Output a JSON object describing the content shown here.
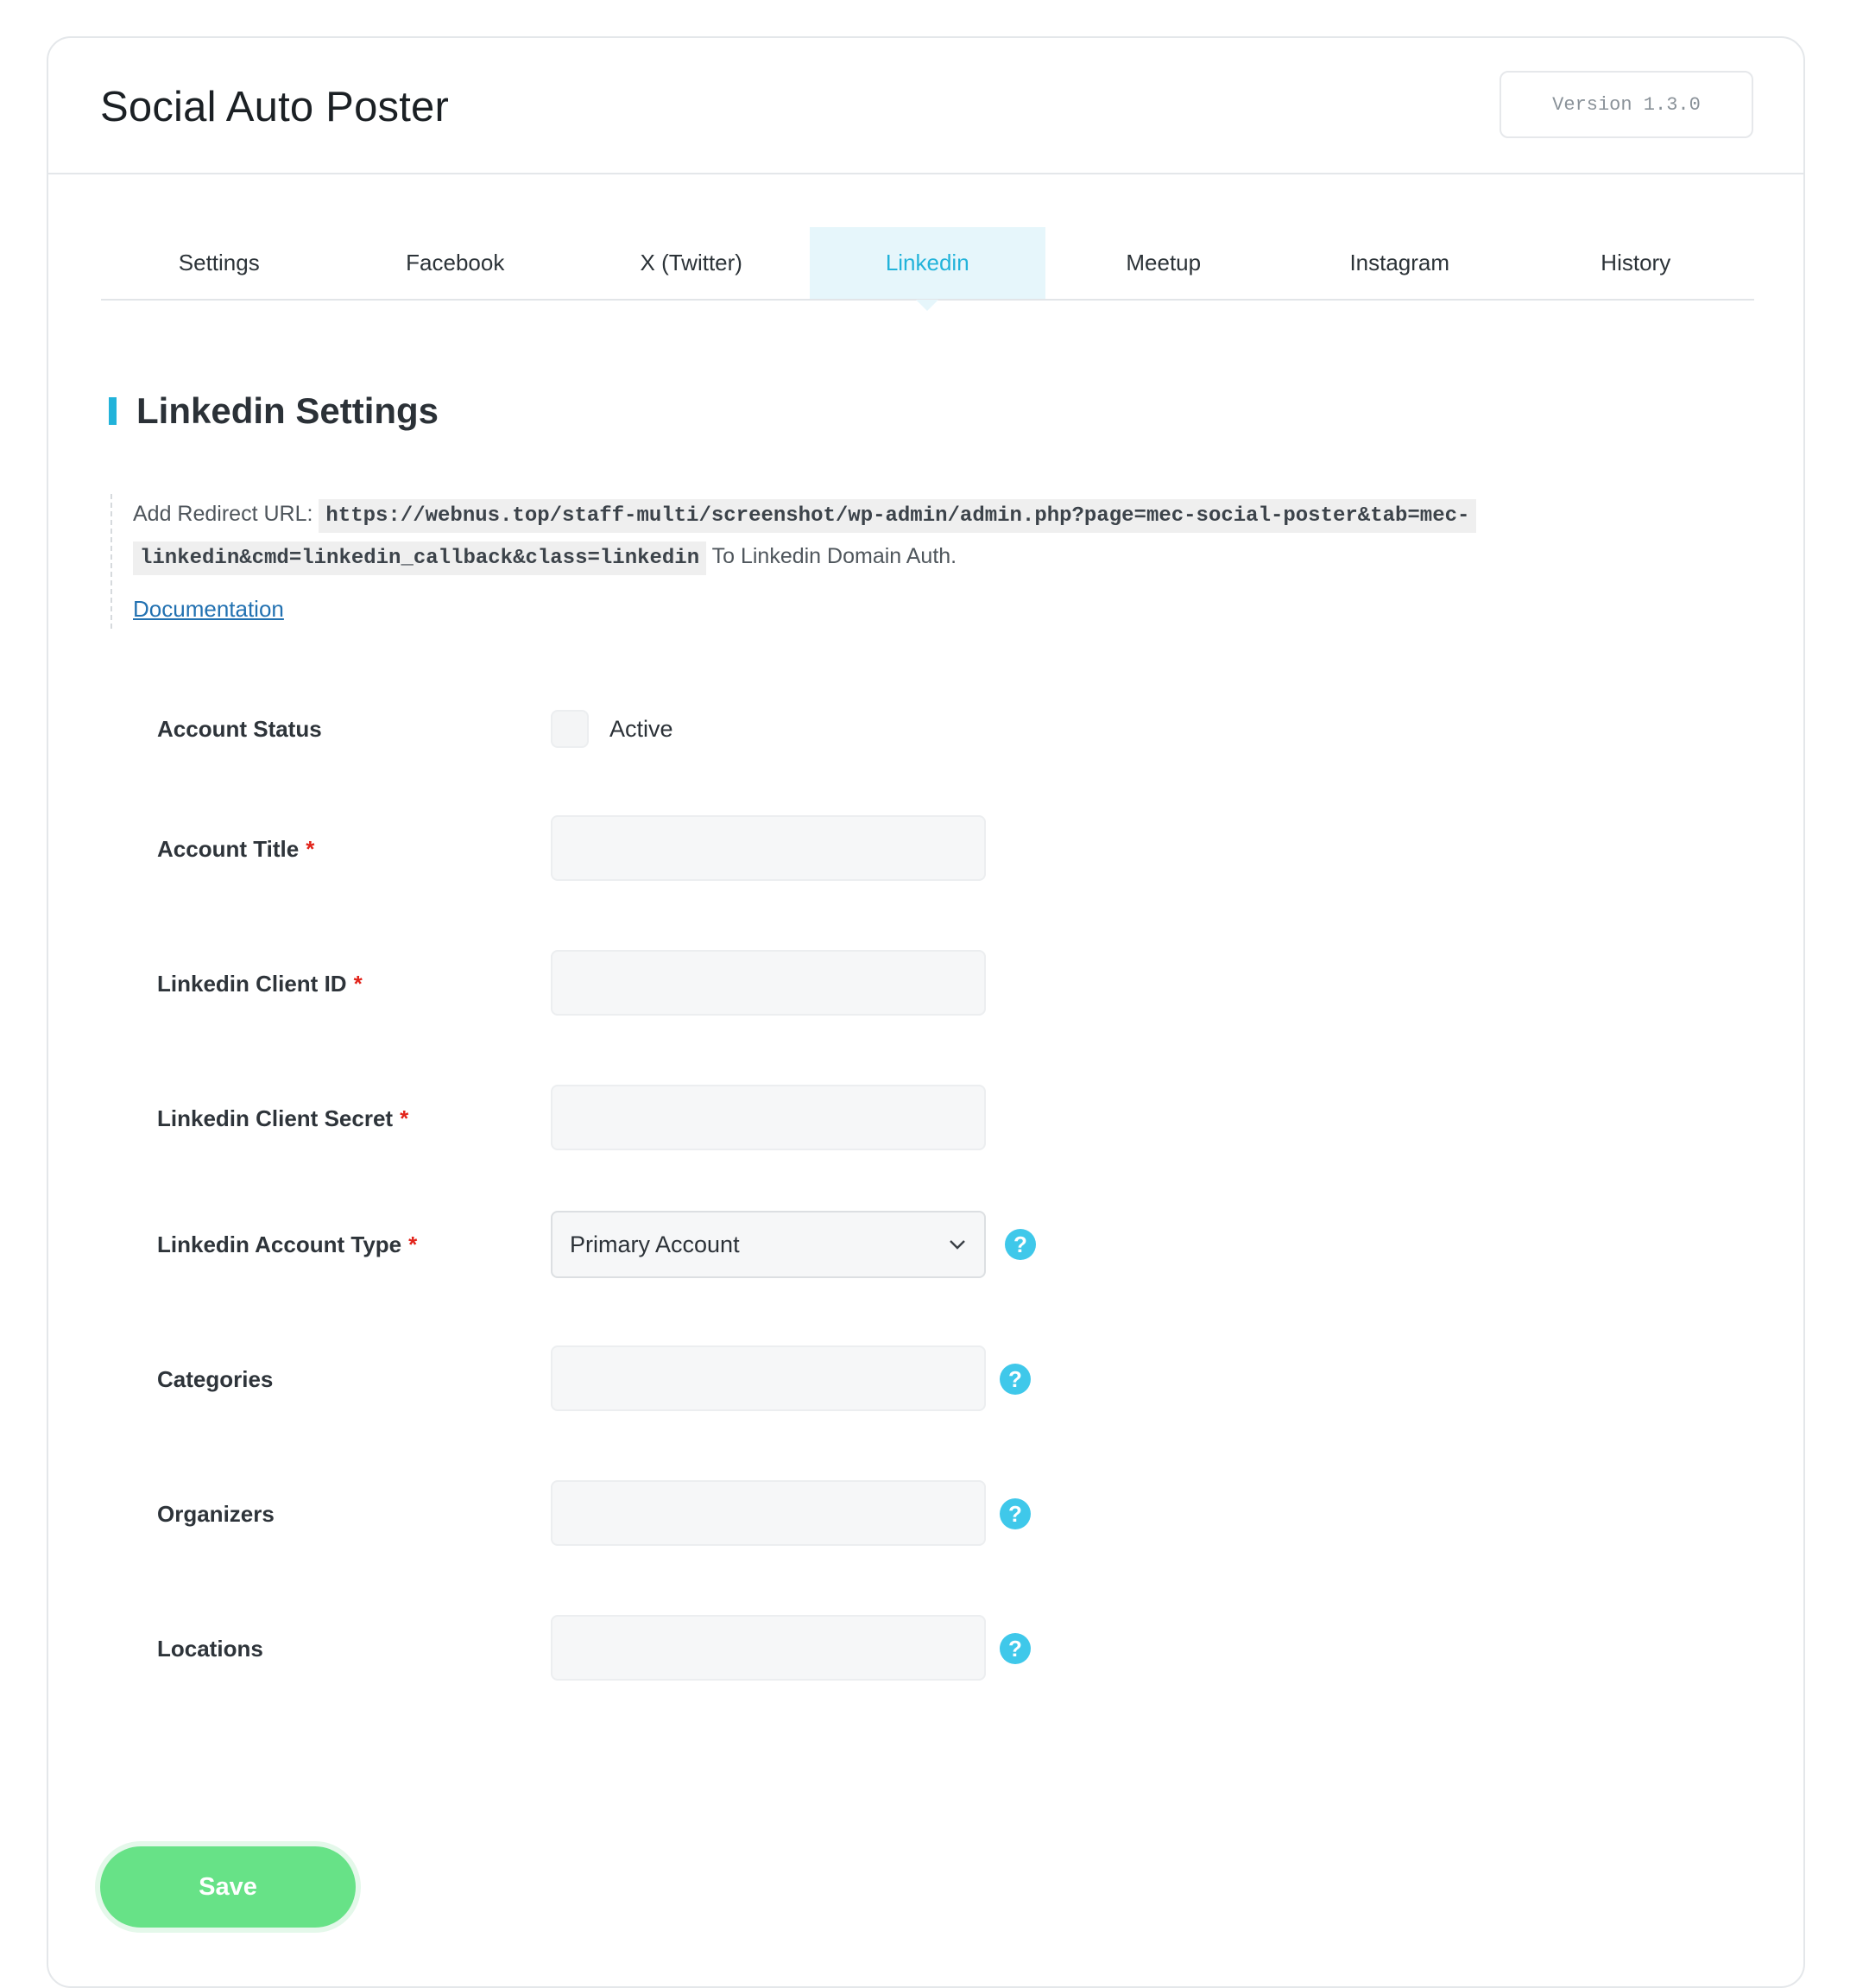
{
  "app": {
    "title": "Social Auto Poster",
    "version": "Version 1.3.0"
  },
  "tabs": [
    {
      "label": "Settings",
      "active": false
    },
    {
      "label": "Facebook",
      "active": false
    },
    {
      "label": "X (Twitter)",
      "active": false
    },
    {
      "label": "Linkedin",
      "active": true
    },
    {
      "label": "Meetup",
      "active": false
    },
    {
      "label": "Instagram",
      "active": false
    },
    {
      "label": "History",
      "active": false
    }
  ],
  "section": {
    "title": "Linkedin Settings",
    "redirect_prefix": "Add Redirect URL:",
    "redirect_url_line1": "https://webnus.top/staff-multi/screenshot/wp-admin/admin.php?page=mec-social-poster&tab=mec-",
    "redirect_url_line2": "linkedin&cmd=linkedin_callback&class=linkedin",
    "redirect_suffix": "To Linkedin Domain Auth.",
    "documentation_link": "Documentation"
  },
  "form": {
    "account_status": {
      "label": "Account Status",
      "checkbox_label": "Active",
      "checked": false
    },
    "account_title": {
      "label": "Account Title",
      "required_mark": "*",
      "value": ""
    },
    "client_id": {
      "label": "Linkedin Client ID",
      "required_mark": "*",
      "value": ""
    },
    "client_secret": {
      "label": "Linkedin Client Secret",
      "required_mark": "*",
      "value": ""
    },
    "account_type": {
      "label": "Linkedin Account Type",
      "required_mark": "*",
      "selected": "Primary Account",
      "help": "?"
    },
    "categories": {
      "label": "Categories",
      "value": "",
      "help": "?"
    },
    "organizers": {
      "label": "Organizers",
      "value": "",
      "help": "?"
    },
    "locations": {
      "label": "Locations",
      "value": "",
      "help": "?"
    }
  },
  "actions": {
    "save_label": "Save"
  },
  "colors": {
    "accent": "#22b3da",
    "help_icon": "#3fc8ea",
    "save_button": "#67e287",
    "required": "#e2231a",
    "link": "#2271b1"
  }
}
